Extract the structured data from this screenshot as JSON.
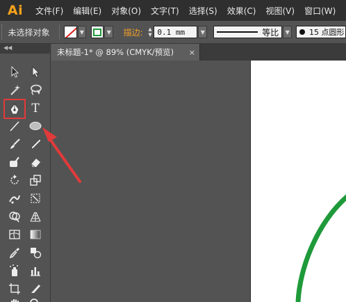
{
  "app": {
    "logo": "Ai"
  },
  "menu": [
    "文件(F)",
    "编辑(E)",
    "对象(O)",
    "文字(T)",
    "选择(S)",
    "效果(C)",
    "视图(V)",
    "窗口(W)"
  ],
  "controlbar": {
    "selection_status": "未选择对象",
    "stroke_label": "描边:",
    "stroke_weight": "0.1 mm",
    "profile_label": "等比",
    "brush_label": "15 点圆形"
  },
  "document_tab": {
    "title": "未标题-1* @ 89% (CMYK/预览)",
    "close_glyph": "×"
  },
  "colors": {
    "fill_indicator": "#e0201c",
    "stroke": "#1f9a3a",
    "annotation": "#e23a3a",
    "logo": "#f7a21b"
  },
  "tools": [
    {
      "id": "selection",
      "icon": "selection-arrow-icon",
      "selected": false
    },
    {
      "id": "direct-selection",
      "icon": "direct-selection-arrow-icon",
      "selected": false
    },
    {
      "id": "magic-wand",
      "icon": "magic-wand-icon",
      "selected": false
    },
    {
      "id": "lasso",
      "icon": "lasso-icon",
      "selected": false
    },
    {
      "id": "pen",
      "icon": "pen-icon",
      "selected": true
    },
    {
      "id": "type",
      "icon": "type-icon",
      "label": "T",
      "selected": false
    },
    {
      "id": "line",
      "icon": "line-segment-icon",
      "selected": false
    },
    {
      "id": "ellipse",
      "icon": "ellipse-icon",
      "selected": false
    },
    {
      "id": "paintbrush",
      "icon": "paintbrush-icon",
      "selected": false
    },
    {
      "id": "pencil",
      "icon": "pencil-icon",
      "selected": false
    },
    {
      "id": "blob-brush",
      "icon": "blob-brush-icon",
      "selected": false
    },
    {
      "id": "eraser",
      "icon": "eraser-icon",
      "selected": false
    },
    {
      "id": "rotate",
      "icon": "rotate-icon",
      "selected": false
    },
    {
      "id": "scale",
      "icon": "scale-icon",
      "selected": false
    },
    {
      "id": "warp",
      "icon": "warp-icon",
      "selected": false
    },
    {
      "id": "free-transform",
      "icon": "free-transform-icon",
      "selected": false
    },
    {
      "id": "shape-builder",
      "icon": "shape-builder-icon",
      "selected": false
    },
    {
      "id": "perspective-grid",
      "icon": "perspective-grid-icon",
      "selected": false
    },
    {
      "id": "mesh",
      "icon": "mesh-icon",
      "selected": false
    },
    {
      "id": "gradient",
      "icon": "gradient-icon",
      "selected": false
    },
    {
      "id": "eyedropper",
      "icon": "eyedropper-icon",
      "selected": false
    },
    {
      "id": "blend",
      "icon": "blend-icon",
      "selected": false
    },
    {
      "id": "symbol-sprayer",
      "icon": "symbol-sprayer-icon",
      "selected": false
    },
    {
      "id": "column-graph",
      "icon": "column-graph-icon",
      "selected": false
    },
    {
      "id": "artboard",
      "icon": "artboard-icon",
      "selected": false
    },
    {
      "id": "slice",
      "icon": "slice-icon",
      "selected": false
    },
    {
      "id": "hand",
      "icon": "hand-icon",
      "selected": false
    },
    {
      "id": "zoom",
      "icon": "zoom-icon",
      "selected": false
    }
  ]
}
